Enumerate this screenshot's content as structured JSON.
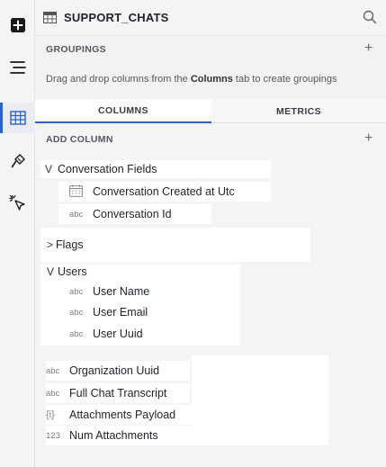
{
  "rail": {
    "items": [
      {
        "name": "add-icon"
      },
      {
        "name": "list-icon"
      },
      {
        "name": "table-icon",
        "active": true
      },
      {
        "name": "brush-icon"
      },
      {
        "name": "cursor-select-icon"
      }
    ]
  },
  "header": {
    "title": "SUPPORT_CHATS"
  },
  "groupings": {
    "label": "GROUPINGS",
    "hint_prefix": "Drag and drop columns from the ",
    "hint_bold": "Columns",
    "hint_suffix": " tab to create groupings"
  },
  "tabs": [
    {
      "label": "COLUMNS",
      "active": true
    },
    {
      "label": "METRICS",
      "active": false
    }
  ],
  "add_column": {
    "label": "ADD COLUMN"
  },
  "groups": {
    "conversation": {
      "chevron": "V",
      "label": "Conversation Fields",
      "fields": [
        {
          "type": "date",
          "label": "Conversation Created at Utc"
        },
        {
          "type": "abc",
          "label": "Conversation Id"
        }
      ]
    },
    "flags": {
      "chevron": ">",
      "label": "Flags"
    },
    "users": {
      "chevron": "V",
      "label": "Users",
      "fields": [
        {
          "type": "abc",
          "label": "User Name"
        },
        {
          "type": "abc",
          "label": "User Email"
        },
        {
          "type": "abc",
          "label": "User Uuid"
        }
      ]
    }
  },
  "loose_fields": [
    {
      "type": "abc",
      "label": "Organization Uuid"
    },
    {
      "type": "abc",
      "label": "Full Chat Transcript"
    },
    {
      "type": "{i}",
      "label": "Attachments Payload"
    },
    {
      "type": "123",
      "label": "Num Attachments"
    }
  ]
}
